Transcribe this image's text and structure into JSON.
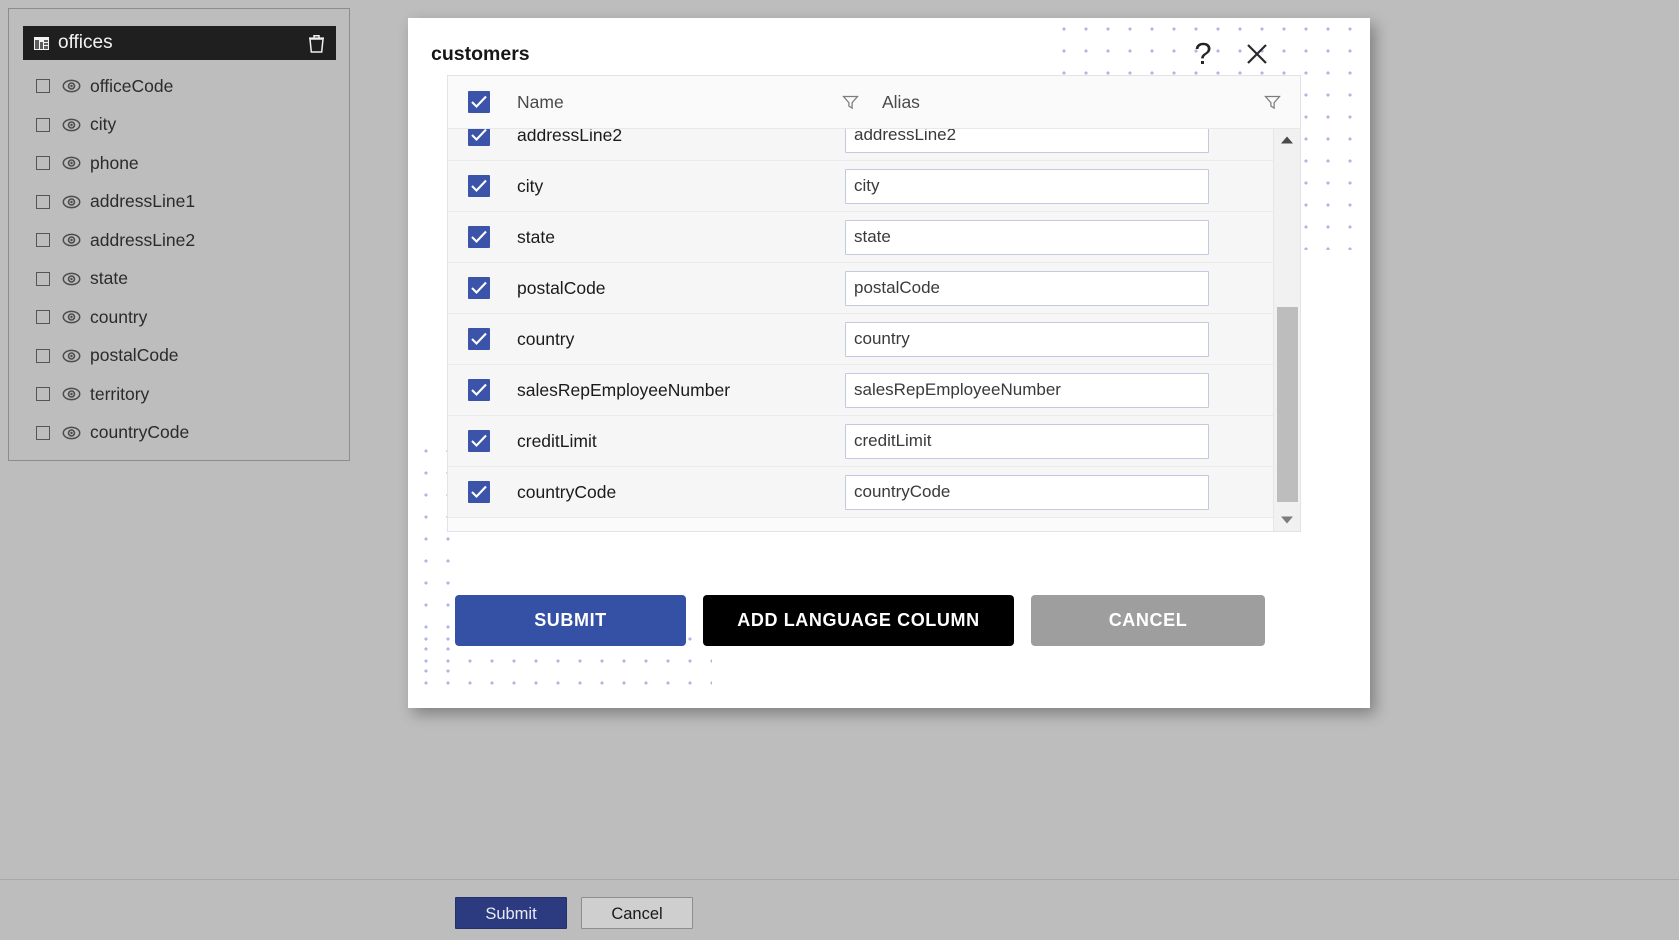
{
  "page": {
    "background_color": "#bdbdbd"
  },
  "sidebar": {
    "header": {
      "title": "offices",
      "table_icon": "table-icon",
      "delete_icon": "trash-icon"
    },
    "fields": [
      {
        "name": "officeCode",
        "checked": false,
        "visibility_icon": "eye-icon"
      },
      {
        "name": "city",
        "checked": false,
        "visibility_icon": "eye-icon"
      },
      {
        "name": "phone",
        "checked": false,
        "visibility_icon": "eye-icon"
      },
      {
        "name": "addressLine1",
        "checked": false,
        "visibility_icon": "eye-icon"
      },
      {
        "name": "addressLine2",
        "checked": false,
        "visibility_icon": "eye-icon"
      },
      {
        "name": "state",
        "checked": false,
        "visibility_icon": "eye-icon"
      },
      {
        "name": "country",
        "checked": false,
        "visibility_icon": "eye-icon"
      },
      {
        "name": "postalCode",
        "checked": false,
        "visibility_icon": "eye-icon"
      },
      {
        "name": "territory",
        "checked": false,
        "visibility_icon": "eye-icon"
      },
      {
        "name": "countryCode",
        "checked": false,
        "visibility_icon": "eye-icon"
      }
    ]
  },
  "dialog": {
    "title": "customers",
    "help_icon": "question-mark-icon",
    "close_icon": "close-icon",
    "table": {
      "select_all_checked": true,
      "columns": [
        {
          "key": "name",
          "label": "Name",
          "filter_icon": "filter-icon"
        },
        {
          "key": "alias",
          "label": "Alias",
          "filter_icon": "filter-icon"
        }
      ],
      "rows": [
        {
          "name": "addressLine2",
          "alias": "addressLine2",
          "checked": true
        },
        {
          "name": "city",
          "alias": "city",
          "checked": true
        },
        {
          "name": "state",
          "alias": "state",
          "checked": true
        },
        {
          "name": "postalCode",
          "alias": "postalCode",
          "checked": true
        },
        {
          "name": "country",
          "alias": "country",
          "checked": true
        },
        {
          "name": "salesRepEmployeeNumber",
          "alias": "salesRepEmployeeNumber",
          "checked": true
        },
        {
          "name": "creditLimit",
          "alias": "creditLimit",
          "checked": true
        },
        {
          "name": "countryCode",
          "alias": "countryCode",
          "checked": true
        }
      ],
      "scrollbar": {
        "up_arrow_icon": "chevron-up-icon",
        "down_arrow_icon": "chevron-down-icon"
      }
    },
    "actions": {
      "submit": "SUBMIT",
      "add_language_column": "ADD LANGUAGE COLUMN",
      "cancel": "CANCEL"
    }
  },
  "footer": {
    "submit": "Submit",
    "cancel": "Cancel"
  },
  "colors": {
    "accent_blue": "#3551a5",
    "checkbox_blue": "#3b53a8",
    "black_button": "#000000",
    "grey_button": "#9e9e9e",
    "footer_primary": "#2c3b80",
    "dot_pattern": "#b0b6e6"
  }
}
